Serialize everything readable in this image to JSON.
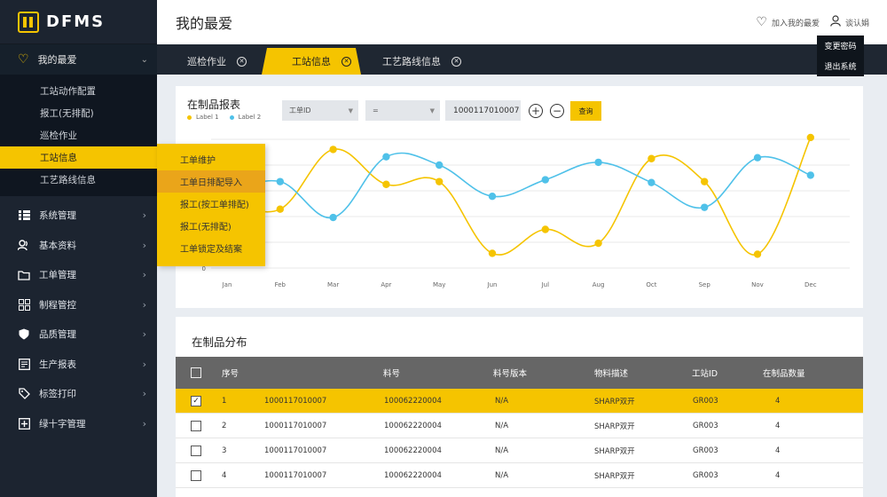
{
  "app": {
    "logo_text": "DFMS"
  },
  "header": {
    "title": "我的最爱",
    "add_fav": "加入我的最爱",
    "user": "谈认娟",
    "dropdown": [
      "变更密码",
      "退出系统"
    ]
  },
  "sidebar": {
    "favorite": {
      "label": "我的最爱",
      "items": [
        "工站动作配置",
        "报工(无排配)",
        "巡检作业",
        "工站信息",
        "工艺路线信息"
      ]
    },
    "menus": [
      {
        "label": "系统管理",
        "icon": "grid-list-icon"
      },
      {
        "label": "基本资料",
        "icon": "users-icon"
      },
      {
        "label": "工单管理",
        "icon": "folder-icon"
      },
      {
        "label": "制程管控",
        "icon": "apps-icon"
      },
      {
        "label": "品质管理",
        "icon": "shield-icon"
      },
      {
        "label": "生产报表",
        "icon": "report-icon"
      },
      {
        "label": "标签打印",
        "icon": "tag-icon"
      },
      {
        "label": "绿十字管理",
        "icon": "plus-square-icon"
      }
    ]
  },
  "flyout": [
    "工单维护",
    "工单日排配导入",
    "报工(按工单排配)",
    "报工(无排配)",
    "工单锁定及结案"
  ],
  "tabs": [
    {
      "label": "巡检作业"
    },
    {
      "label": "工站信息"
    },
    {
      "label": "工艺路线信息"
    }
  ],
  "chart_card": {
    "title": "在制品报表",
    "filter_field": "工单ID",
    "filter_op": "=",
    "filter_value": "1000117010007",
    "plus": "+",
    "minus": "−",
    "query": "查询"
  },
  "chart_data": {
    "type": "line",
    "categories": [
      "Jan",
      "Feb",
      "Mar",
      "Apr",
      "May",
      "Jun",
      "Jul",
      "Aug",
      "Oct",
      "Sep",
      "Nov",
      "Dec"
    ],
    "y_tick_label": "0",
    "ylim": [
      0,
      140
    ],
    "grid": true,
    "legend_position": "top-left",
    "series": [
      {
        "name": "Label 1",
        "color": "#f5c400",
        "values": [
          74,
          64,
          129,
          91,
          94,
          16,
          42,
          27,
          119,
          94,
          15,
          142
        ]
      },
      {
        "name": "Label 2",
        "color": "#4fc1e9",
        "values": [
          82,
          94,
          55,
          121,
          112,
          78,
          96,
          115,
          93,
          66,
          120,
          101
        ]
      }
    ]
  },
  "table_card": {
    "title": "在制品分布",
    "headers": [
      "序号",
      "料号",
      "料号版本",
      "物料描述",
      "工站ID",
      "在制品数量"
    ],
    "rows": [
      {
        "checked": true,
        "mark": "✓",
        "cells": [
          "1",
          "1000117010007",
          "100062220004",
          "N/A",
          "SHARP双开",
          "GR003",
          "4"
        ]
      },
      {
        "checked": false,
        "mark": "",
        "cells": [
          "2",
          "1000117010007",
          "100062220004",
          "N/A",
          "SHARP双开",
          "GR003",
          "4"
        ]
      },
      {
        "checked": false,
        "mark": "",
        "cells": [
          "3",
          "1000117010007",
          "100062220004",
          "N/A",
          "SHARP双开",
          "GR003",
          "4"
        ]
      },
      {
        "checked": false,
        "mark": "",
        "cells": [
          "4",
          "1000117010007",
          "100062220004",
          "N/A",
          "SHARP双开",
          "GR003",
          "4"
        ]
      }
    ]
  }
}
